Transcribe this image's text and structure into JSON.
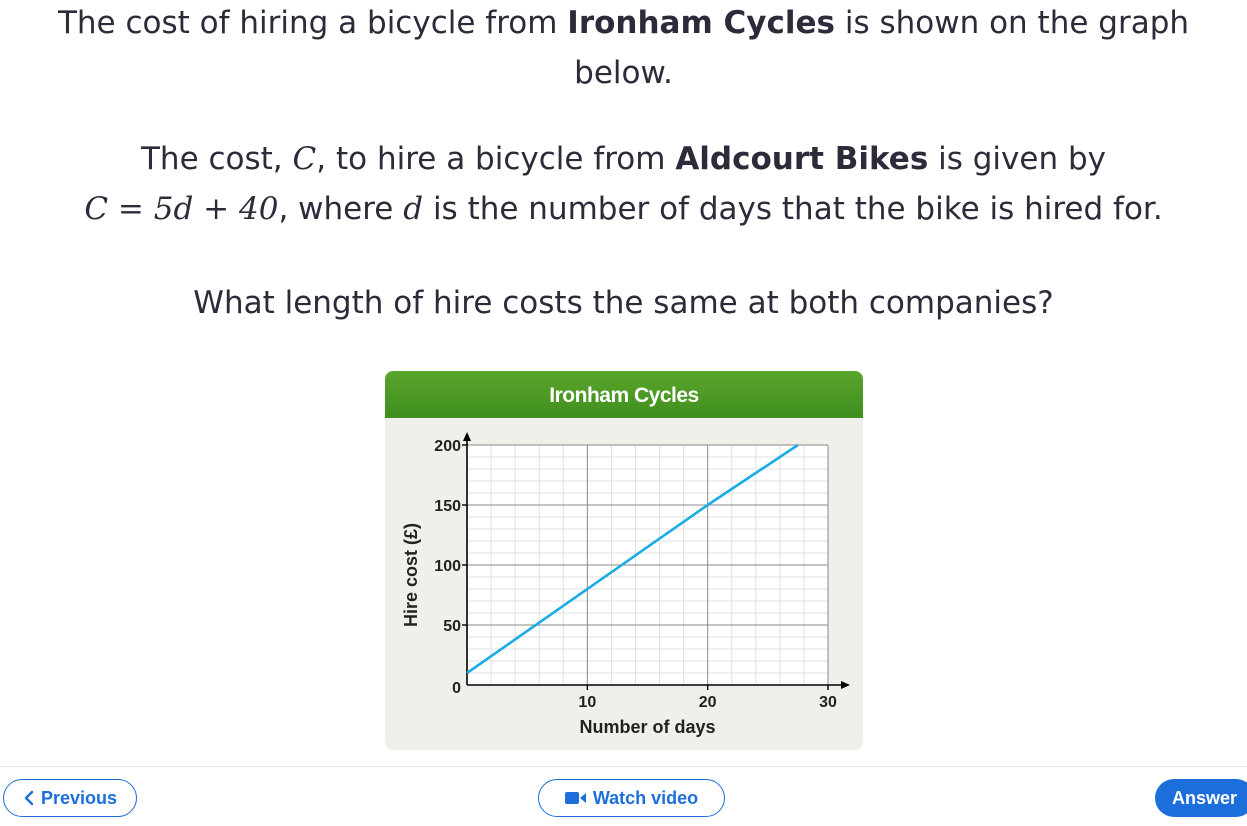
{
  "question": {
    "p1_text_a": "The cost of hiring a bicycle from ",
    "p1_bold": "Ironham Cycles",
    "p1_text_b": " is shown on the graph",
    "p1_text_c": "below.",
    "p2_text_a": "The cost, ",
    "p2_var_c": "C",
    "p2_text_b": ", to hire a bicycle from ",
    "p2_bold": "Aldcourt Bikes",
    "p2_text_c": " is given by",
    "p2_eq_lhs": "C",
    "p2_eq_op": " = 5",
    "p2_eq_var": "d",
    "p2_eq_rest": " + 40",
    "p2_text_d": ", where ",
    "p2_var_d": "d",
    "p2_text_e": " is the number of days that the bike is hired for.",
    "p3_text": "What length of hire costs the same at both companies?"
  },
  "chart_data": {
    "type": "line",
    "title": "Ironham Cycles",
    "xlabel": "Number of days",
    "ylabel": "Hire cost (£)",
    "xlim": [
      0,
      30
    ],
    "ylim": [
      0,
      200
    ],
    "x_ticks": [
      "0",
      "10",
      "20",
      "30"
    ],
    "y_ticks": [
      "50",
      "100",
      "150",
      "200"
    ],
    "grid": true,
    "series": [
      {
        "x": [
          0,
          20,
          27.5
        ],
        "y": [
          10,
          150,
          200
        ]
      }
    ],
    "colors": {
      "line": "#1aace5",
      "header": "#4a9a27"
    }
  },
  "footer": {
    "previous_label": "Previous",
    "watch_video_label": "Watch video",
    "answer_label": "Answer"
  },
  "icons": {
    "previous": "chevron-left-icon",
    "video": "video-camera-icon"
  }
}
